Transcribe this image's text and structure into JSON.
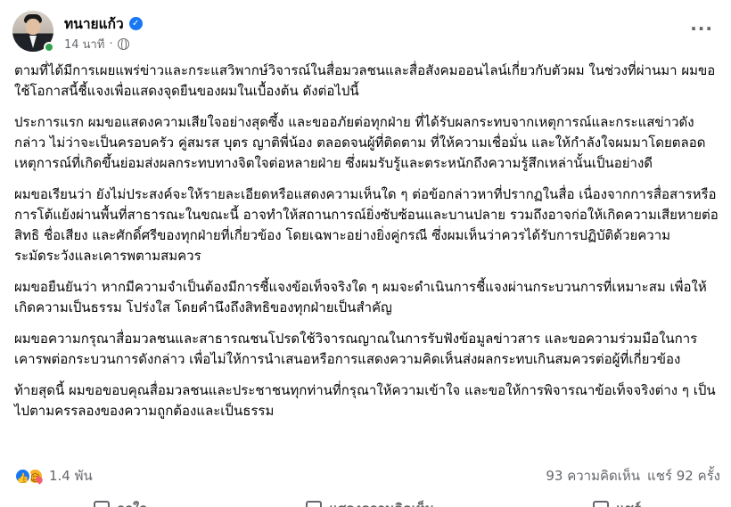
{
  "post": {
    "author": "ทนายแก้ว",
    "time": "14 นาที",
    "time_separator": "·",
    "paragraphs": [
      "ตามที่ได้มีการเผยแพร่ข่าวและกระแสวิพากษ์วิจารณ์ในสื่อมวลชนและสื่อสังคมออนไลน์เกี่ยวกับตัวผม ในช่วงที่ผ่านมา ผมขอใช้โอกาสนี้ชี้แจงเพื่อแสดงจุดยืนของผมในเบื้องต้น ดังต่อไปนี้",
      "ประการแรก ผมขอแสดงความเสียใจอย่างสุดซึ้ง และขออภัยต่อทุกฝ่าย ที่ได้รับผลกระทบจากเหตุการณ์และกระแสข่าวดังกล่าว ไม่ว่าจะเป็นครอบครัว คู่สมรส บุตร ญาติพี่น้อง ตลอดจนผู้ที่ติดตาม ที่ให้ความเชื่อมั่น และให้กำลังใจผมมาโดยตลอด เหตุการณ์ที่เกิดขึ้นย่อมส่งผลกระทบทางจิตใจต่อหลายฝ่าย ซึ่งผมรับรู้และตระหนักถึงความรู้สึกเหล่านั้นเป็นอย่างดี",
      "ผมขอเรียนว่า ยังไม่ประสงค์จะให้รายละเอียดหรือแสดงความเห็นใด ๆ ต่อข้อกล่าวหาที่ปรากฏในสื่อ เนื่องจากการสื่อสารหรือการโต้แย้งผ่านพื้นที่สาธารณะในขณะนี้ อาจทำให้สถานการณ์ยิ่งซับซ้อนและบานปลาย รวมถึงอาจก่อให้เกิดความเสียหายต่อสิทธิ ชื่อเสียง และศักดิ์ศรีของทุกฝ่ายที่เกี่ยวข้อง โดยเฉพาะอย่างยิ่งคู่กรณี ซึ่งผมเห็นว่าควรได้รับการปฏิบัติด้วยความระมัดระวังและเคารพตามสมควร",
      "ผมขอยืนยันว่า หากมีความจำเป็นต้องมีการชี้แจงข้อเท็จจริงใด ๆ ผมจะดำเนินการชี้แจงผ่านกระบวนการที่เหมาะสม เพื่อให้เกิดความเป็นธรรม โปร่งใส โดยคำนึงถึงสิทธิของทุกฝ่ายเป็นสำคัญ",
      "ผมขอความกรุณาสื่อมวลชนและสาธารณชนโปรดใช้วิจารณญาณในการรับฟังข้อมูลข่าวสาร และขอความร่วมมือในการเคารพต่อกระบวนการดังกล่าว เพื่อไม่ให้การนำเสนอหรือการแสดงความคิดเห็นส่งผลกระทบเกินสมควรต่อผู้ที่เกี่ยวข้อง",
      "ท้ายสุดนี้ ผมขอขอบคุณสื่อมวลชนและประชาชนทุกท่านที่กรุณาให้ความเข้าใจ และขอให้การพิจารณาข้อเท็จจริงต่าง ๆ เป็นไปตามครรลองของความถูกต้องและเป็นธรรม"
    ]
  },
  "stats": {
    "reactions": "1.4 พัน",
    "comments": "93 ความคิดเห็น",
    "shares": "แชร์ 92 ครั้ง"
  },
  "actions": {
    "like": "ถูกใจ",
    "comment": "แสดงความคิดเห็น",
    "share": "แชร์"
  },
  "colors": {
    "brand_blue": "#1877f2",
    "online_green": "#31a24c",
    "secondary_text": "#65676b"
  },
  "icons": [
    "verified-badge-icon",
    "globe-icon",
    "more-options-icon",
    "like-reaction-icon",
    "care-reaction-icon"
  ]
}
